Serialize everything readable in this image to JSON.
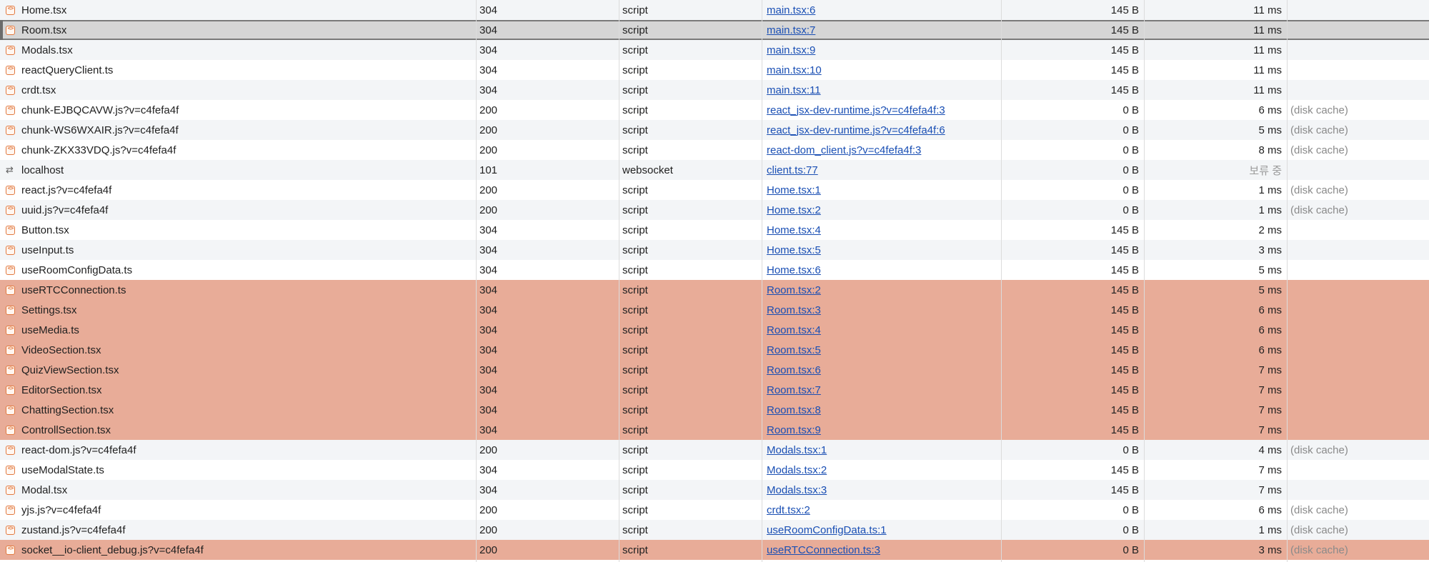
{
  "rows": [
    {
      "name": "Home.tsx",
      "status": "304",
      "type": "script",
      "initiator": "main.tsx:6",
      "size": "145 B",
      "time": "11 ms",
      "cache": "",
      "icon": "script-icon",
      "highlight": false,
      "selected": false
    },
    {
      "name": "Room.tsx",
      "status": "304",
      "type": "script",
      "initiator": "main.tsx:7",
      "size": "145 B",
      "time": "11 ms",
      "cache": "",
      "icon": "script-icon",
      "highlight": false,
      "selected": true
    },
    {
      "name": "Modals.tsx",
      "status": "304",
      "type": "script",
      "initiator": "main.tsx:9",
      "size": "145 B",
      "time": "11 ms",
      "cache": "",
      "icon": "script-icon",
      "highlight": false,
      "selected": false
    },
    {
      "name": "reactQueryClient.ts",
      "status": "304",
      "type": "script",
      "initiator": "main.tsx:10",
      "size": "145 B",
      "time": "11 ms",
      "cache": "",
      "icon": "script-icon",
      "highlight": false,
      "selected": false
    },
    {
      "name": "crdt.tsx",
      "status": "304",
      "type": "script",
      "initiator": "main.tsx:11",
      "size": "145 B",
      "time": "11 ms",
      "cache": "",
      "icon": "script-icon",
      "highlight": false,
      "selected": false
    },
    {
      "name": "chunk-EJBQCAVW.js?v=c4fefa4f",
      "status": "200",
      "type": "script",
      "initiator": "react_jsx-dev-runtime.js?v=c4fefa4f:3",
      "size": "0 B",
      "time": "6 ms",
      "cache": "(disk cache)",
      "icon": "script-icon",
      "highlight": false,
      "selected": false
    },
    {
      "name": "chunk-WS6WXAIR.js?v=c4fefa4f",
      "status": "200",
      "type": "script",
      "initiator": "react_jsx-dev-runtime.js?v=c4fefa4f:6",
      "size": "0 B",
      "time": "5 ms",
      "cache": "(disk cache)",
      "icon": "script-icon",
      "highlight": false,
      "selected": false
    },
    {
      "name": "chunk-ZKX33VDQ.js?v=c4fefa4f",
      "status": "200",
      "type": "script",
      "initiator": "react-dom_client.js?v=c4fefa4f:3",
      "size": "0 B",
      "time": "8 ms",
      "cache": "(disk cache)",
      "icon": "script-icon",
      "highlight": false,
      "selected": false
    },
    {
      "name": "localhost",
      "status": "101",
      "type": "websocket",
      "initiator": "client.ts:77",
      "size": "0 B",
      "time": "보류 중",
      "cache": "",
      "icon": "websocket-icon",
      "highlight": false,
      "selected": false,
      "pending": true
    },
    {
      "name": "react.js?v=c4fefa4f",
      "status": "200",
      "type": "script",
      "initiator": "Home.tsx:1",
      "size": "0 B",
      "time": "1 ms",
      "cache": "(disk cache)",
      "icon": "script-icon",
      "highlight": false,
      "selected": false
    },
    {
      "name": "uuid.js?v=c4fefa4f",
      "status": "200",
      "type": "script",
      "initiator": "Home.tsx:2",
      "size": "0 B",
      "time": "1 ms",
      "cache": "(disk cache)",
      "icon": "script-icon",
      "highlight": false,
      "selected": false
    },
    {
      "name": "Button.tsx",
      "status": "304",
      "type": "script",
      "initiator": "Home.tsx:4",
      "size": "145 B",
      "time": "2 ms",
      "cache": "",
      "icon": "script-icon",
      "highlight": false,
      "selected": false
    },
    {
      "name": "useInput.ts",
      "status": "304",
      "type": "script",
      "initiator": "Home.tsx:5",
      "size": "145 B",
      "time": "3 ms",
      "cache": "",
      "icon": "script-icon",
      "highlight": false,
      "selected": false
    },
    {
      "name": "useRoomConfigData.ts",
      "status": "304",
      "type": "script",
      "initiator": "Home.tsx:6",
      "size": "145 B",
      "time": "5 ms",
      "cache": "",
      "icon": "script-icon",
      "highlight": false,
      "selected": false
    },
    {
      "name": "useRTCConnection.ts",
      "status": "304",
      "type": "script",
      "initiator": "Room.tsx:2",
      "size": "145 B",
      "time": "5 ms",
      "cache": "",
      "icon": "script-icon",
      "highlight": true,
      "selected": false
    },
    {
      "name": "Settings.tsx",
      "status": "304",
      "type": "script",
      "initiator": "Room.tsx:3",
      "size": "145 B",
      "time": "6 ms",
      "cache": "",
      "icon": "script-icon",
      "highlight": true,
      "selected": false
    },
    {
      "name": "useMedia.ts",
      "status": "304",
      "type": "script",
      "initiator": "Room.tsx:4",
      "size": "145 B",
      "time": "6 ms",
      "cache": "",
      "icon": "script-icon",
      "highlight": true,
      "selected": false
    },
    {
      "name": "VideoSection.tsx",
      "status": "304",
      "type": "script",
      "initiator": "Room.tsx:5",
      "size": "145 B",
      "time": "6 ms",
      "cache": "",
      "icon": "script-icon",
      "highlight": true,
      "selected": false
    },
    {
      "name": "QuizViewSection.tsx",
      "status": "304",
      "type": "script",
      "initiator": "Room.tsx:6",
      "size": "145 B",
      "time": "7 ms",
      "cache": "",
      "icon": "script-icon",
      "highlight": true,
      "selected": false
    },
    {
      "name": "EditorSection.tsx",
      "status": "304",
      "type": "script",
      "initiator": "Room.tsx:7",
      "size": "145 B",
      "time": "7 ms",
      "cache": "",
      "icon": "script-icon",
      "highlight": true,
      "selected": false
    },
    {
      "name": "ChattingSection.tsx",
      "status": "304",
      "type": "script",
      "initiator": "Room.tsx:8",
      "size": "145 B",
      "time": "7 ms",
      "cache": "",
      "icon": "script-icon",
      "highlight": true,
      "selected": false
    },
    {
      "name": "ControllSection.tsx",
      "status": "304",
      "type": "script",
      "initiator": "Room.tsx:9",
      "size": "145 B",
      "time": "7 ms",
      "cache": "",
      "icon": "script-icon",
      "highlight": true,
      "selected": false
    },
    {
      "name": "react-dom.js?v=c4fefa4f",
      "status": "200",
      "type": "script",
      "initiator": "Modals.tsx:1",
      "size": "0 B",
      "time": "4 ms",
      "cache": "(disk cache)",
      "icon": "script-icon",
      "highlight": false,
      "selected": false
    },
    {
      "name": "useModalState.ts",
      "status": "304",
      "type": "script",
      "initiator": "Modals.tsx:2",
      "size": "145 B",
      "time": "7 ms",
      "cache": "",
      "icon": "script-icon",
      "highlight": false,
      "selected": false
    },
    {
      "name": "Modal.tsx",
      "status": "304",
      "type": "script",
      "initiator": "Modals.tsx:3",
      "size": "145 B",
      "time": "7 ms",
      "cache": "",
      "icon": "script-icon",
      "highlight": false,
      "selected": false
    },
    {
      "name": "yjs.js?v=c4fefa4f",
      "status": "200",
      "type": "script",
      "initiator": "crdt.tsx:2",
      "size": "0 B",
      "time": "6 ms",
      "cache": "(disk cache)",
      "icon": "script-icon",
      "highlight": false,
      "selected": false
    },
    {
      "name": "zustand.js?v=c4fefa4f",
      "status": "200",
      "type": "script",
      "initiator": "useRoomConfigData.ts:1",
      "size": "0 B",
      "time": "1 ms",
      "cache": "(disk cache)",
      "icon": "script-icon",
      "highlight": false,
      "selected": false
    },
    {
      "name": "socket__io-client_debug.js?v=c4fefa4f",
      "status": "200",
      "type": "script",
      "initiator": "useRTCConnection.ts:3",
      "size": "0 B",
      "time": "3 ms",
      "cache": "(disk cache)",
      "icon": "script-icon",
      "highlight": true,
      "selected": false
    }
  ]
}
